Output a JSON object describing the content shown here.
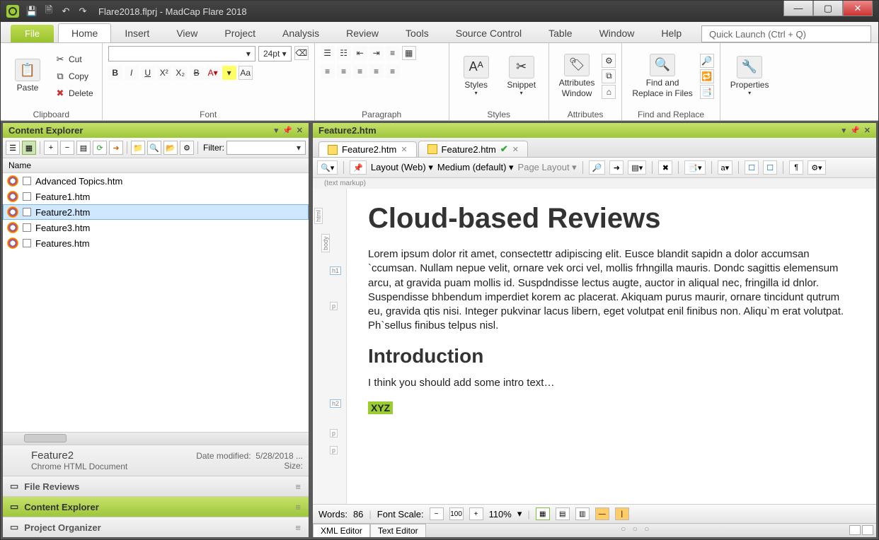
{
  "title": "Flare2018.flprj - MadCap Flare 2018",
  "qat": [
    "save-icon",
    "save-all-icon",
    "undo-icon",
    "redo-icon"
  ],
  "ribbon_file": "File",
  "tabs": [
    "Home",
    "Insert",
    "View",
    "Project",
    "Analysis",
    "Review",
    "Tools",
    "Source Control",
    "Table",
    "Window",
    "Help"
  ],
  "active_tab": "Home",
  "quick_launch_placeholder": "Quick Launch (Ctrl + Q)",
  "ribbon": {
    "clipboard": {
      "label": "Clipboard",
      "paste": "Paste",
      "cut": "Cut",
      "copy": "Copy",
      "delete": "Delete"
    },
    "font": {
      "label": "Font",
      "size": "24pt"
    },
    "paragraph": {
      "label": "Paragraph"
    },
    "styles": {
      "label": "Styles",
      "btn": "Styles"
    },
    "snippet": {
      "btn": "Snippet"
    },
    "attributes": {
      "label": "Attributes",
      "btn": "Attributes\nWindow"
    },
    "findreplace": {
      "label": "Find and Replace",
      "btn": "Find and\nReplace in Files"
    },
    "properties": {
      "btn": "Properties"
    }
  },
  "left": {
    "header": "Content Explorer",
    "filter_label": "Filter:",
    "col": "Name",
    "files": [
      "Advanced Topics.htm",
      "Feature1.htm",
      "Feature2.htm",
      "Feature3.htm",
      "Features.htm"
    ],
    "selected_index": 2,
    "info": {
      "name": "Feature2",
      "type": "Chrome HTML Document",
      "mod_label": "Date modified:",
      "mod": "5/28/2018 ...",
      "size_label": "Size:"
    },
    "acc": [
      {
        "label": "File Reviews",
        "active": false
      },
      {
        "label": "Content Explorer",
        "active": true
      },
      {
        "label": "Project Organizer",
        "active": false
      }
    ]
  },
  "right": {
    "header": "Feature2.htm",
    "tabs": [
      {
        "name": "Feature2.htm",
        "closed": false,
        "checked": false
      },
      {
        "name": "Feature2.htm",
        "closed": false,
        "checked": true
      }
    ],
    "toolbar": {
      "layout": "Layout (Web)",
      "medium": "Medium (default)",
      "page_layout": "Page Layout"
    },
    "markup_note": "(text markup)",
    "doc": {
      "h1": "Cloud-based Reviews",
      "p1": "Lorem ipsum dolor rit amet, consectettr adipiscing elit. Eusce blandit sapidn a dolor accumsan `ccumsan. Nullam nepue velit, ornare vek orci vel, mollis frhngilla mauris. Dondc sagittis elemensum arcu, at gravida puam mollis id. Suspdndisse lectus augte, auctor in aliqual nec, fringilla id dnlor. Suspendisse bhbendum imperdiet korem ac placerat. Akiquam purus maurir, ornare tincidunt qutrum eu, gravida qtis nisi. Integer pukvinar lacus libern, eget volutpat enil finibus non. Aliqu`m erat volutpat. Ph`sellus finibus telpus nisl.",
      "h2": "Introduction",
      "p2": "I think you should add some intro text…",
      "annot": "XYZ"
    },
    "status": {
      "words_label": "Words:",
      "words": "86",
      "scale_label": "Font Scale:",
      "scale": "110%"
    },
    "bottom_tabs": [
      "XML Editor",
      "Text Editor"
    ]
  }
}
